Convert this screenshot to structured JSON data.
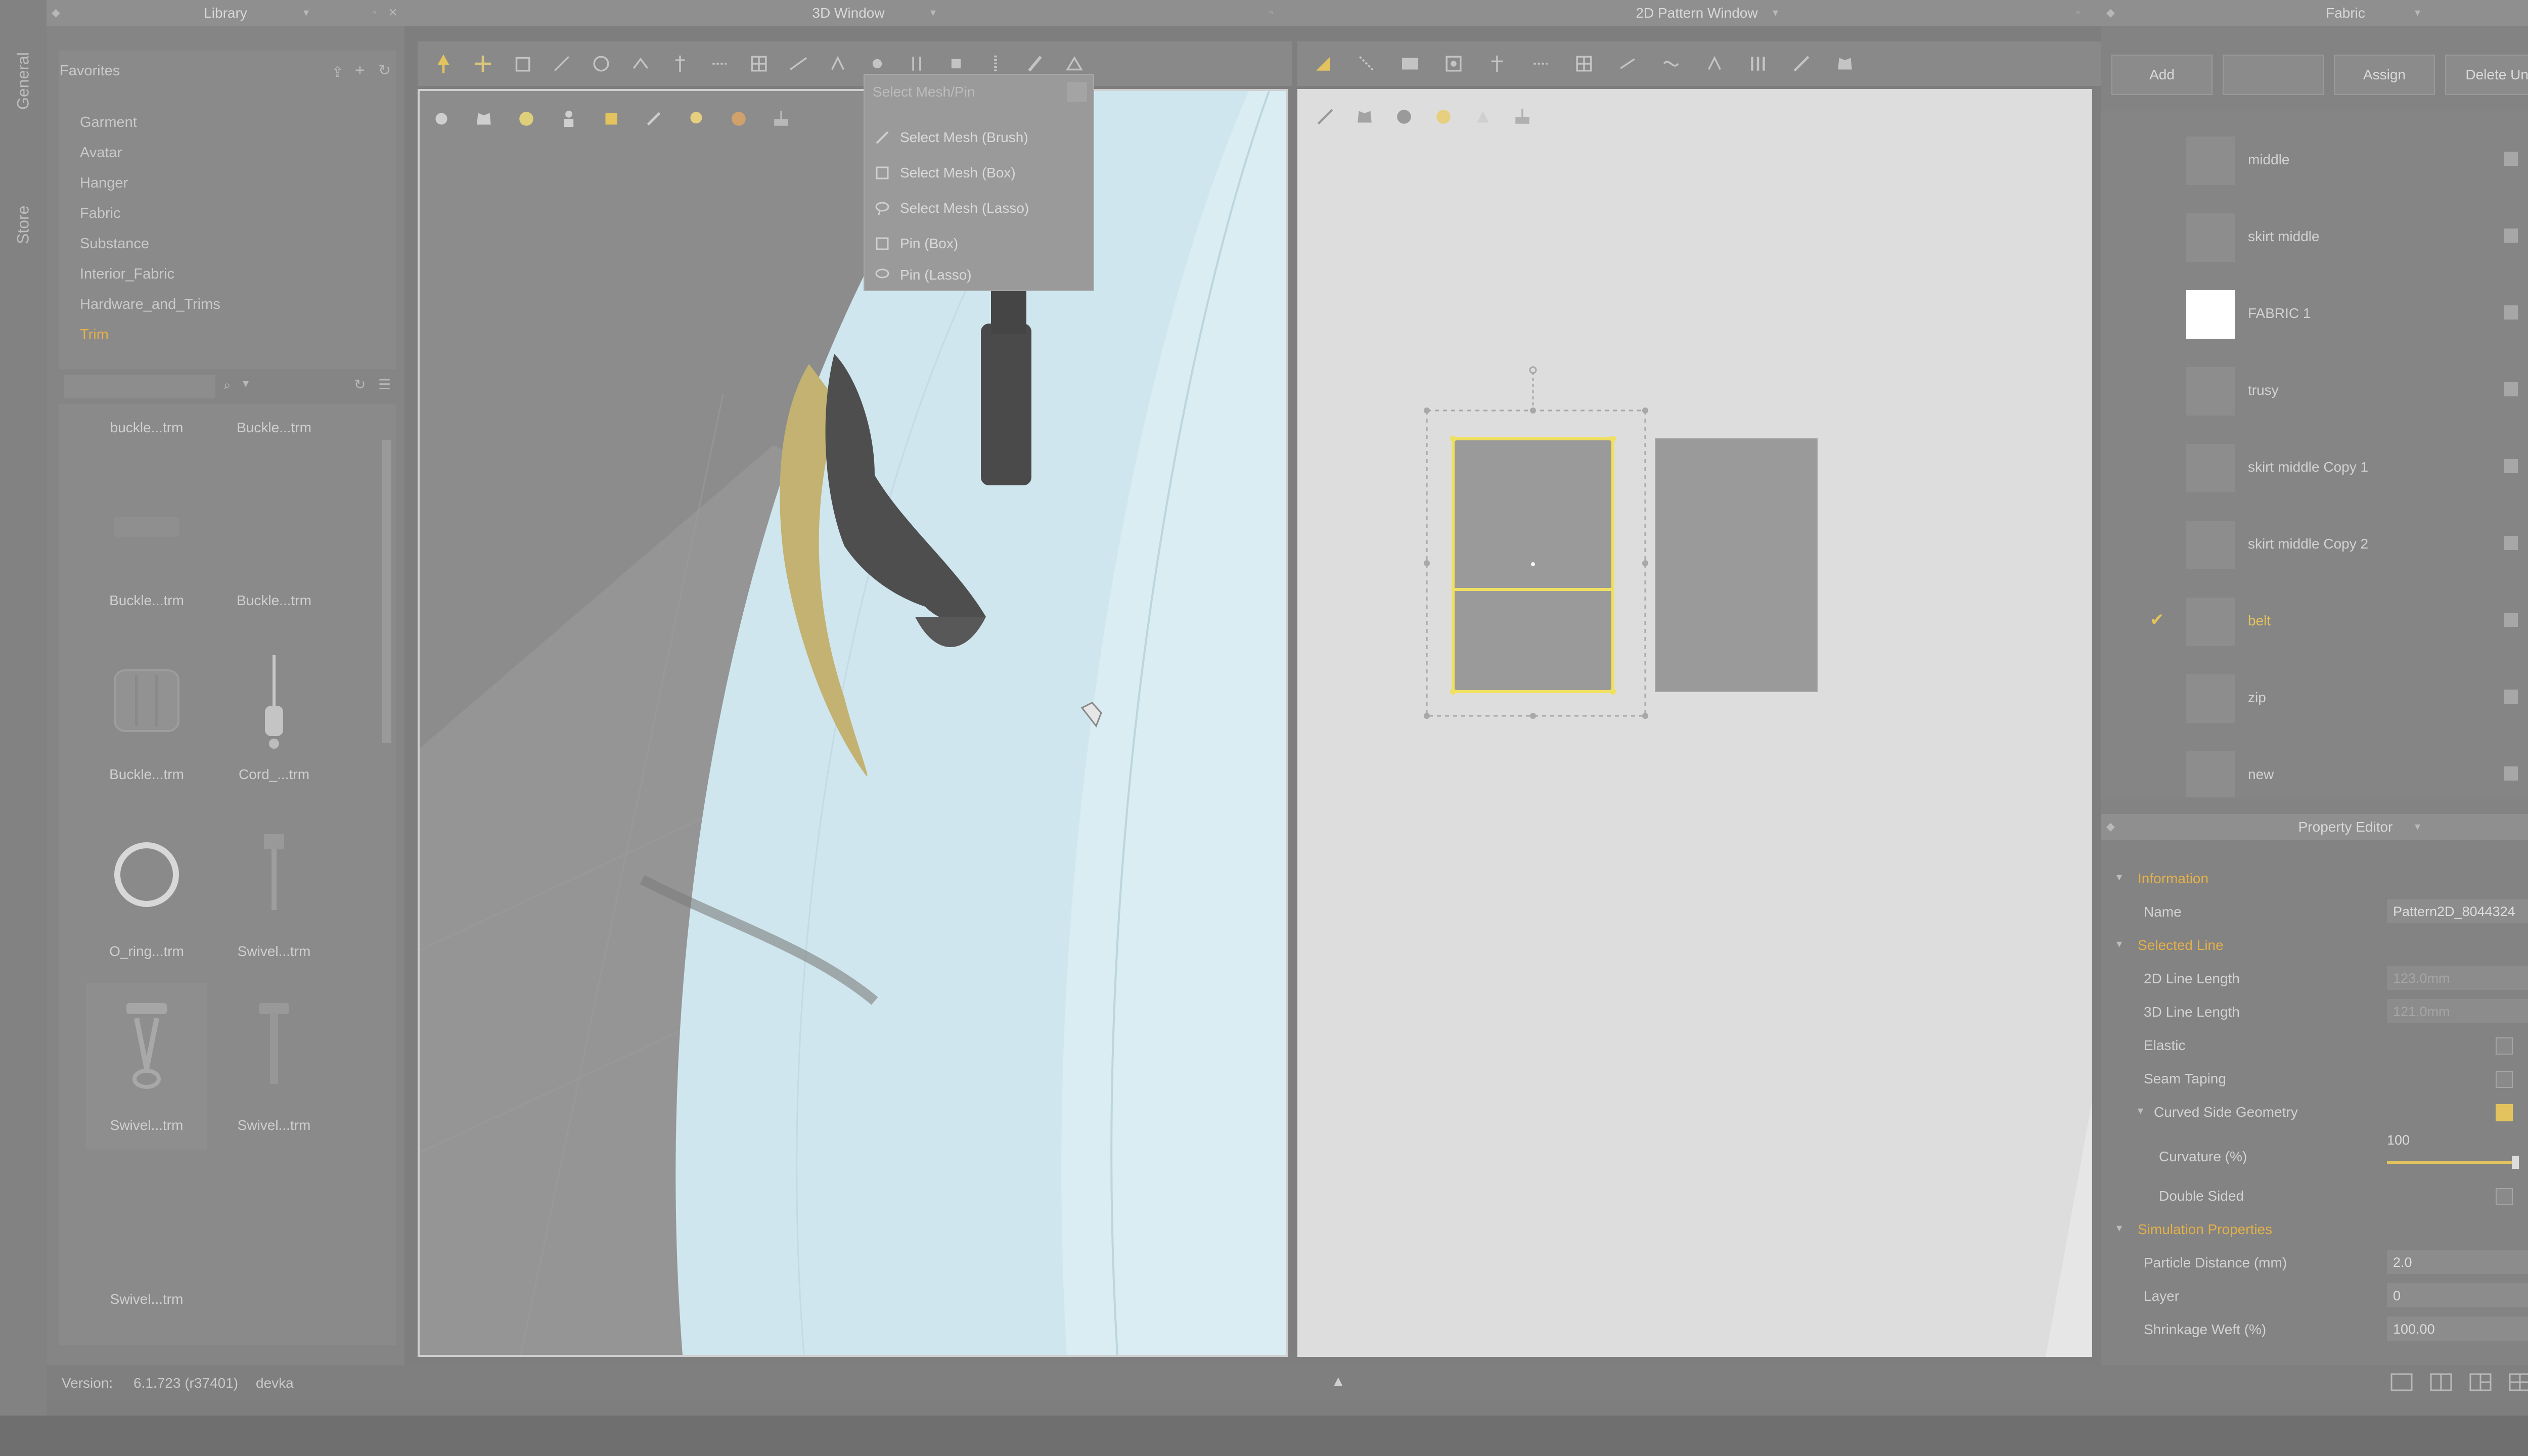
{
  "left_rail": {
    "tabs": [
      "General",
      "Store"
    ]
  },
  "library": {
    "title": "Library",
    "favorites_label": "Favorites",
    "categories": [
      "Garment",
      "Avatar",
      "Hanger",
      "Fabric",
      "Substance",
      "Interior_Fabric",
      "Hardware_and_Trims",
      "Trim"
    ],
    "selected_category": "Trim",
    "items": [
      {
        "label": "buckle...trm"
      },
      {
        "label": "Buckle...trm"
      },
      {
        "label": "Buckle...trm"
      },
      {
        "label": "Buckle...trm"
      },
      {
        "label": "Buckle...trm"
      },
      {
        "label": "Cord_...trm"
      },
      {
        "label": "O_ring...trm"
      },
      {
        "label": "Swivel...trm"
      },
      {
        "label": "Swivel...trm"
      },
      {
        "label": "Swivel...trm"
      },
      {
        "label": "Swivel...trm"
      }
    ]
  },
  "window3d": {
    "title": "3D Window"
  },
  "window2d": {
    "title": "2D Pattern Window"
  },
  "dropdown": {
    "header": "Select Mesh/Pin",
    "items": [
      "Select Mesh (Brush)",
      "Select Mesh (Box)",
      "Select Mesh (Lasso)",
      "Pin (Box)",
      "Pin (Lasso)"
    ]
  },
  "fabric": {
    "title": "Fabric",
    "buttons": {
      "add": "Add",
      "assign": "Assign",
      "delete_unused": "Delete Unused"
    },
    "items": [
      {
        "name": "middle",
        "checked": false
      },
      {
        "name": "skirt middle",
        "checked": false
      },
      {
        "name": "FABRIC 1",
        "checked": false,
        "swatch": "#ffffff"
      },
      {
        "name": "trusy",
        "checked": false
      },
      {
        "name": "skirt middle Copy 1",
        "checked": false
      },
      {
        "name": "skirt middle Copy 2",
        "checked": false
      },
      {
        "name": "belt",
        "checked": true
      },
      {
        "name": "zip",
        "checked": false
      },
      {
        "name": "new",
        "checked": false
      }
    ]
  },
  "property_editor": {
    "title": "Property Editor",
    "information": "Information",
    "name_label": "Name",
    "name_value": "Pattern2D_8044324",
    "selected_line": "Selected Line",
    "line2d_label": "2D Line Length",
    "line2d_value": "123.0mm",
    "line3d_label": "3D Line Length",
    "line3d_value": "121.0mm",
    "elastic_label": "Elastic",
    "seam_taping_label": "Seam Taping",
    "curved_label": "Curved Side Geometry",
    "curvature_label": "Curvature (%)",
    "curvature_value": "100",
    "double_sided_label": "Double Sided",
    "simulation": "Simulation Properties",
    "particle_label": "Particle Distance (mm)",
    "particle_value": "2.0",
    "layer_label": "Layer",
    "layer_value": "0",
    "shrink_label": "Shrinkage Weft (%)",
    "shrink_value": "100.00"
  },
  "status": {
    "version_label": "Version:",
    "version_value": "6.1.723 (r37401)",
    "build": "devka"
  },
  "colors": {
    "accent": "#e3c35e",
    "selection": "#f0e060",
    "garment": "#cfe6ee"
  }
}
